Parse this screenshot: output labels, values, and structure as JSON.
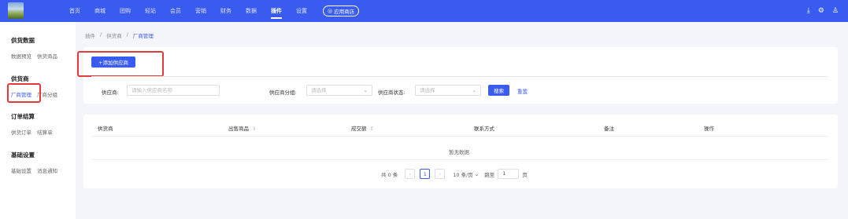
{
  "topnav": {
    "items": [
      "首页",
      "商城",
      "团购",
      "轻站",
      "会员",
      "营销",
      "财务",
      "数据",
      "插件",
      "设置"
    ],
    "active": "插件",
    "store_label": "应用商店"
  },
  "sidebar": {
    "groups": [
      {
        "title": "供货数据",
        "items": [
          "数据预览",
          "供货商品"
        ]
      },
      {
        "title": "供货商",
        "items": [
          "厂商管理",
          "厂商分组"
        ]
      },
      {
        "title": "订单结算",
        "items": [
          "供货订单",
          "结算单"
        ]
      },
      {
        "title": "基础设置",
        "items": [
          "基础设置",
          "消息通知"
        ]
      }
    ],
    "active_item": "厂商管理"
  },
  "breadcrumb": [
    "插件",
    "供货商",
    "厂商管理"
  ],
  "toolbar": {
    "add_label": "+添加供应商"
  },
  "filters": {
    "supplier_label": "供应商:",
    "supplier_placeholder": "请输入供应商名称",
    "group_label": "供应商分组:",
    "group_placeholder": "请选择",
    "status_label": "供应商状态:",
    "status_placeholder": "请选择",
    "search_label": "搜索",
    "reset_label": "重置"
  },
  "table": {
    "columns": [
      "供货商",
      "出售商品",
      "成交额",
      "联系方式",
      "备注",
      "操作"
    ],
    "empty_text": "暂无数据"
  },
  "pagination": {
    "total": "共 0 条",
    "prev": "‹",
    "current": "1",
    "next": "›",
    "page_size": "10 条/页",
    "jump_label": "跳至",
    "jump_value": "1",
    "page_unit": "页"
  },
  "colors": {
    "primary": "#3a5bf0",
    "highlight": "#e23b3b"
  }
}
